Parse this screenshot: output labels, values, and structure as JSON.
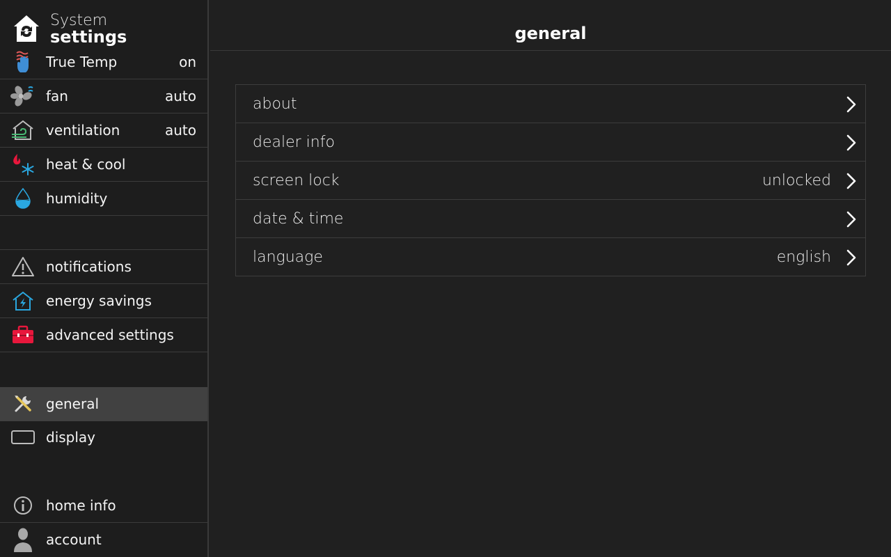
{
  "sidebar": {
    "title_line1": "System",
    "title_line2": "settings",
    "items": [
      {
        "label": "True Temp",
        "value": "on",
        "icon": "true-temp-icon"
      },
      {
        "label": "fan",
        "value": "auto",
        "icon": "fan-icon"
      },
      {
        "label": "ventilation",
        "value": "auto",
        "icon": "ventilation-icon"
      },
      {
        "label": "heat & cool",
        "value": "",
        "icon": "heat-cool-icon"
      },
      {
        "label": "humidity",
        "value": "",
        "icon": "humidity-icon"
      },
      {
        "label": "notifications",
        "value": "",
        "icon": "warning-icon"
      },
      {
        "label": "energy savings",
        "value": "",
        "icon": "energy-savings-icon"
      },
      {
        "label": "advanced settings",
        "value": "",
        "icon": "toolbox-icon"
      },
      {
        "label": "general",
        "value": "",
        "icon": "tools-icon",
        "active": true
      },
      {
        "label": "display",
        "value": "",
        "icon": "display-icon"
      },
      {
        "label": "home info",
        "value": "",
        "icon": "info-icon"
      },
      {
        "label": "account",
        "value": "",
        "icon": "person-icon"
      }
    ]
  },
  "main": {
    "title": "general",
    "rows": [
      {
        "label": "about",
        "value": ""
      },
      {
        "label": "dealer info",
        "value": ""
      },
      {
        "label": "screen lock",
        "value": "unlocked"
      },
      {
        "label": "date & time",
        "value": ""
      },
      {
        "label": "language",
        "value": "english"
      }
    ]
  },
  "colors": {
    "background": "#202020",
    "sidebar_active": "#414141",
    "accent_blue": "#2aa7e0",
    "accent_red": "#e8173c"
  }
}
